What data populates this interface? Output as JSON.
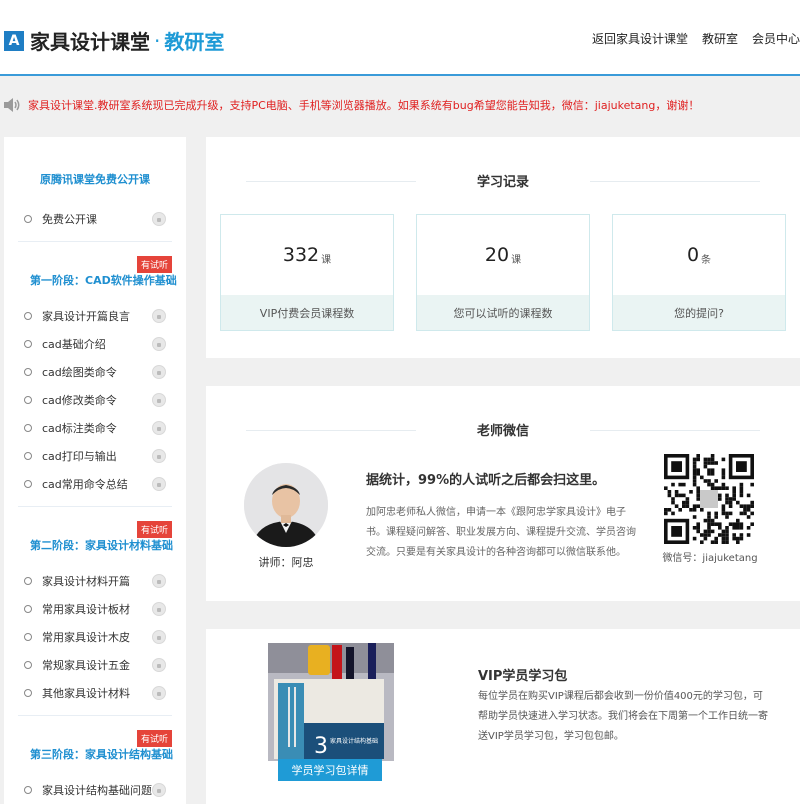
{
  "header": {
    "logo_mark": "A",
    "logo_text": "家具设计课堂",
    "logo_dot": "·",
    "logo_sub": "教研室",
    "nav": [
      "返回家具设计课堂",
      "教研室",
      "会员中心"
    ]
  },
  "notice": {
    "icon": "speaker-icon",
    "text": "家具设计课堂.教研室系统现已完成升级，支持PC电脑、手机等浏览器播放。如果系统有bug希望您能告知我，微信：jiajuketang，谢谢！"
  },
  "sidebar": {
    "free_title": "原腾讯课堂免费公开课",
    "free_items": [
      "免费公开课"
    ],
    "stages": [
      {
        "badge": "有试听",
        "title": "第一阶段：CAD软件操作基础",
        "items": [
          "家具设计开篇良言",
          "cad基础介绍",
          "cad绘图类命令",
          "cad修改类命令",
          "cad标注类命令",
          "cad打印与输出",
          "cad常用命令总结"
        ]
      },
      {
        "badge": "有试听",
        "title": "第二阶段：家具设计材料基础",
        "items": [
          "家具设计材料开篇",
          "常用家具设计板材",
          "常用家具设计木皮",
          "常规家具设计五金",
          "其他家具设计材料"
        ]
      },
      {
        "badge": "有试听",
        "title": "第三阶段：家具设计结构基础",
        "items": [
          "家具设计结构基础问题"
        ]
      }
    ]
  },
  "records": {
    "title": "学习记录",
    "stats": [
      {
        "value": "332",
        "unit": "课",
        "label": "VIP付费会员课程数"
      },
      {
        "value": "20",
        "unit": "课",
        "label": "您可以试听的课程数"
      },
      {
        "value": "0",
        "unit": "条",
        "label": "您的提问?"
      }
    ]
  },
  "wechat": {
    "title": "老师微信",
    "teacher_name": "讲师：阿忠",
    "headline": "据统计，99%的人试听之后都会扫这里。",
    "desc": "加阿忠老师私人微信，申请一本《跟阿忠学家具设计》电子书。课程疑问解答、职业发展方向、课程提升交流、学员咨询交流。只要是有关家具设计的各种咨询都可以微信联系他。",
    "qr_caption": "微信号：jiajuketang"
  },
  "package": {
    "title": "VIP学员学习包",
    "desc": "每位学员在购买VIP课程后都会收到一份价值400元的学习包，可帮助学员快速进入学习状态。我们将会在下周第一个工作日统一寄送VIP学员学习包，学习包包邮。",
    "button": "学员学习包详情",
    "book_number": "3",
    "book_label": "家具设计结构基础"
  },
  "colors": {
    "accent_blue": "#1f9bd6",
    "notice_red": "#e02020",
    "badge_red": "#e5443a",
    "stat_bg": "#eaf4f3"
  }
}
